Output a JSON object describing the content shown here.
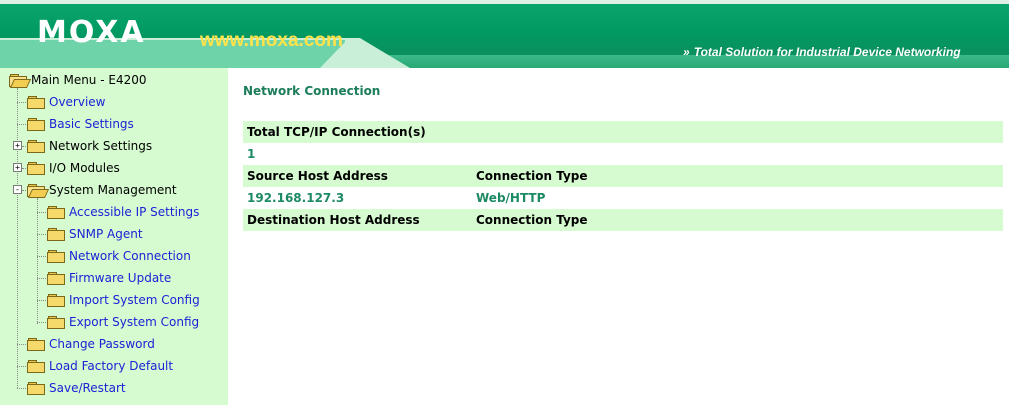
{
  "header": {
    "logo": "MOXA",
    "site_link": "www.moxa.com",
    "tagline_chevrons": "»",
    "tagline": "Total Solution for Industrial Device Networking",
    "colors": {
      "band": "#019a62",
      "link": "#ffe34a",
      "tab": "#6fd3a9"
    }
  },
  "sidebar": {
    "root": {
      "label": "Main Menu - E4200",
      "icon": "open-folder-icon"
    },
    "items": [
      {
        "label": "Overview",
        "icon": "folder-icon",
        "link": true
      },
      {
        "label": "Basic Settings",
        "icon": "folder-icon",
        "link": true
      },
      {
        "label": "Network Settings",
        "icon": "folder-icon",
        "expander": "+",
        "link": false
      },
      {
        "label": "I/O Modules",
        "icon": "folder-icon",
        "expander": "+",
        "link": false
      },
      {
        "label": "System Management",
        "icon": "open-folder-icon",
        "expander": "-",
        "link": false
      },
      {
        "label": "Accessible IP Settings",
        "icon": "folder-icon",
        "link": true
      },
      {
        "label": "SNMP Agent",
        "icon": "folder-icon",
        "link": true
      },
      {
        "label": "Network Connection",
        "icon": "folder-icon",
        "link": true
      },
      {
        "label": "Firmware Update",
        "icon": "folder-icon",
        "link": true
      },
      {
        "label": "Import System Config",
        "icon": "folder-icon",
        "link": true
      },
      {
        "label": "Export System Config",
        "icon": "folder-icon",
        "link": true
      },
      {
        "label": "Change Password",
        "icon": "folder-icon",
        "link": true
      },
      {
        "label": "Load Factory Default",
        "icon": "folder-icon",
        "link": true
      },
      {
        "label": "Save/Restart",
        "icon": "folder-icon",
        "link": true
      }
    ],
    "colors": {
      "background": "#d7fbd0",
      "link": "#1a22d6"
    }
  },
  "main": {
    "title": "Network Connection",
    "total_header": "Total TCP/IP Connection(s)",
    "total_value": "1",
    "source_header": "Source Host Address",
    "source_type_header": "Connection Type",
    "source_rows": [
      {
        "address": "192.168.127.3",
        "type": "Web/HTTP"
      }
    ],
    "dest_header": "Destination Host Address",
    "dest_type_header": "Connection Type",
    "colors": {
      "title": "#1c7d5a",
      "value": "#1c8a62",
      "header_bg": "#d7fbd0"
    }
  }
}
